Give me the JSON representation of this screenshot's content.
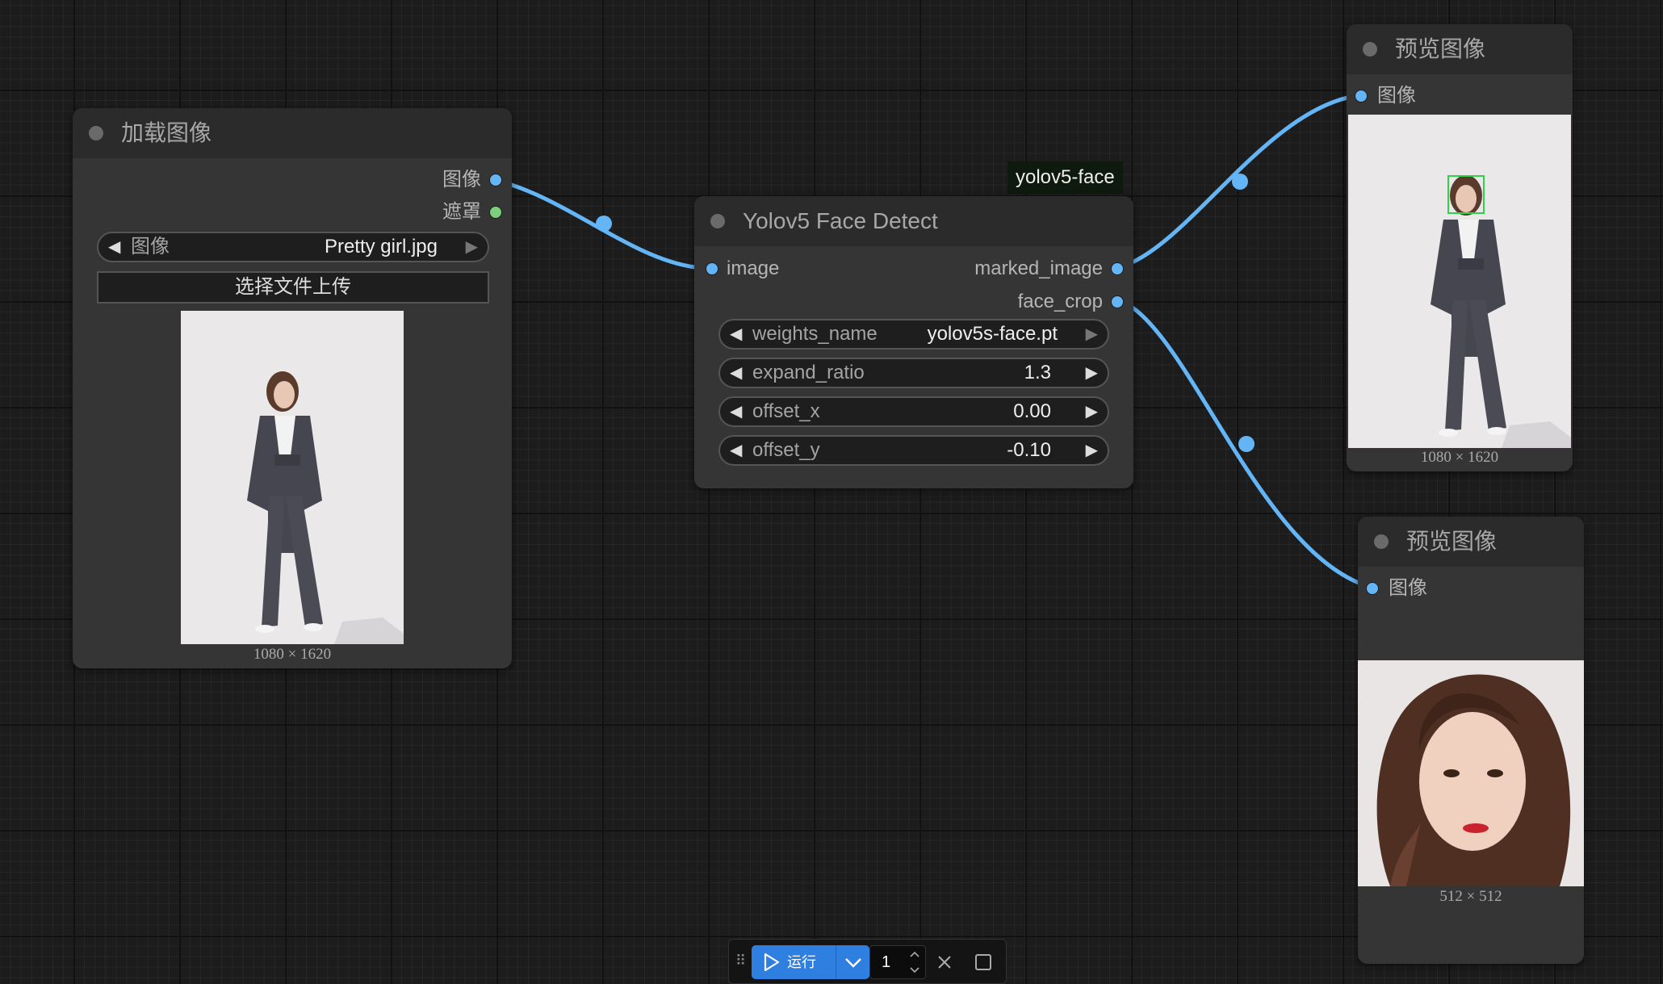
{
  "load_image_node": {
    "title": "加载图像",
    "outputs": [
      "图像",
      "遮罩"
    ],
    "image_widget": {
      "label": "图像",
      "value": "Pretty girl.jpg"
    },
    "upload_button": "选择文件上传",
    "image_size": "1080 × 1620"
  },
  "face_detect_node": {
    "badge": "yolov5-face",
    "title": "Yolov5 Face Detect",
    "input": "image",
    "outputs": [
      "marked_image",
      "face_crop"
    ],
    "widgets": [
      {
        "label": "weights_name",
        "value": "yolov5s-face.pt"
      },
      {
        "label": "expand_ratio",
        "value": "1.3"
      },
      {
        "label": "offset_x",
        "value": "0.00"
      },
      {
        "label": "offset_y",
        "value": "-0.10"
      }
    ]
  },
  "preview_node_1": {
    "title": "预览图像",
    "input": "图像",
    "image_size": "1080 × 1620"
  },
  "preview_node_2": {
    "title": "预览图像",
    "input": "图像",
    "image_size": "512 × 512"
  },
  "toolbar": {
    "run_label": "运行",
    "queue_count": "1"
  },
  "colors": {
    "link": "#64b5f6",
    "run_button": "#2f7fe0",
    "mask_port": "#7ccf7c"
  }
}
